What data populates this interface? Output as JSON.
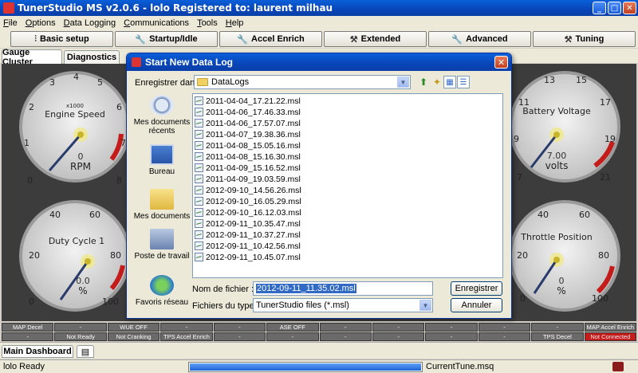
{
  "window": {
    "title": "TunerStudio MS v2.0.6 - lolo Registered to: laurent milhau",
    "controls": [
      "_",
      "□",
      "✕"
    ]
  },
  "menu": [
    "File",
    "Options",
    "Data Logging",
    "Communications",
    "Tools",
    "Help"
  ],
  "toolbar": [
    {
      "label": "Basic setup",
      "icon": "sliders-icon"
    },
    {
      "label": "Startup/Idle",
      "icon": "wrench-icon"
    },
    {
      "label": "Accel Enrich",
      "icon": "wrench-icon"
    },
    {
      "label": "Extended",
      "icon": "hammer-icon"
    },
    {
      "label": "Advanced",
      "icon": "wrench-icon"
    },
    {
      "label": "Tuning",
      "icon": "tools-icon"
    }
  ],
  "tabs": [
    "Gauge Cluster",
    "Diagnostics"
  ],
  "gauges": {
    "engine_speed": {
      "title": "Engine Speed",
      "unit_scale": "x1000",
      "value": "0",
      "unit": "RPM",
      "ticks": [
        "0",
        "1",
        "2",
        "3",
        "4",
        "5",
        "6",
        "7",
        "8"
      ]
    },
    "duty_cycle": {
      "title": "Duty Cycle 1",
      "value": "0.0",
      "unit": "%",
      "ticks": [
        "0",
        "20",
        "40",
        "60",
        "80",
        "100"
      ]
    },
    "battery": {
      "title": "Battery Voltage",
      "value": "7.00",
      "unit": "volts",
      "ticks": [
        "7",
        "9",
        "11",
        "13",
        "15",
        "17",
        "19",
        "21"
      ]
    },
    "throttle": {
      "title": "Throttle Position",
      "value": "0",
      "unit": "%",
      "ticks": [
        "0",
        "20",
        "40",
        "60",
        "80",
        "100"
      ]
    }
  },
  "indicators": {
    "row1": [
      "MAP Decel",
      "-",
      "WUE OFF",
      "-",
      "-",
      "ASE OFF",
      "-",
      "-",
      "-",
      "-",
      "-",
      "MAP Accel Enrich"
    ],
    "row2": [
      "-",
      "Not Ready",
      "Not Cranking",
      "TPS Accel Enrich",
      "-",
      "-",
      "-",
      "-",
      "-",
      "-",
      "TPS Decel",
      "Not Connected"
    ]
  },
  "bottom_tabs": {
    "main": "Main Dashboard"
  },
  "status": {
    "left": "lolo Ready",
    "progress": 1.0,
    "file": "CurrentTune.msq"
  },
  "dialog": {
    "title": "Start New Data Log",
    "save_in_label": "Enregistrer dans :",
    "save_in_value": "DataLogs",
    "places": [
      "Mes documents récents",
      "Bureau",
      "Mes documents",
      "Poste de travail",
      "Favoris réseau"
    ],
    "files": [
      "2011-04-04_17.21.22.msl",
      "2011-04-06_17.46.33.msl",
      "2011-04-06_17.57.07.msl",
      "2011-04-07_19.38.36.msl",
      "2011-04-08_15.05.16.msl",
      "2011-04-08_15.16.30.msl",
      "2011-04-09_15.16.52.msl",
      "2011-04-09_19.03.59.msl",
      "2012-09-10_14.56.26.msl",
      "2012-09-10_16.05.29.msl",
      "2012-09-10_16.12.03.msl",
      "2012-09-11_10.35.47.msl",
      "2012-09-11_10.37.27.msl",
      "2012-09-11_10.42.56.msl",
      "2012-09-11_10.45.07.msl"
    ],
    "filename_label": "Nom de fichier :",
    "filename_value": "2012-09-11_11.35.02.msl",
    "filetype_label": "Fichiers du type :",
    "filetype_value": "TunerStudio files (*.msl)",
    "save_button": "Enregistrer",
    "cancel_button": "Annuler"
  }
}
